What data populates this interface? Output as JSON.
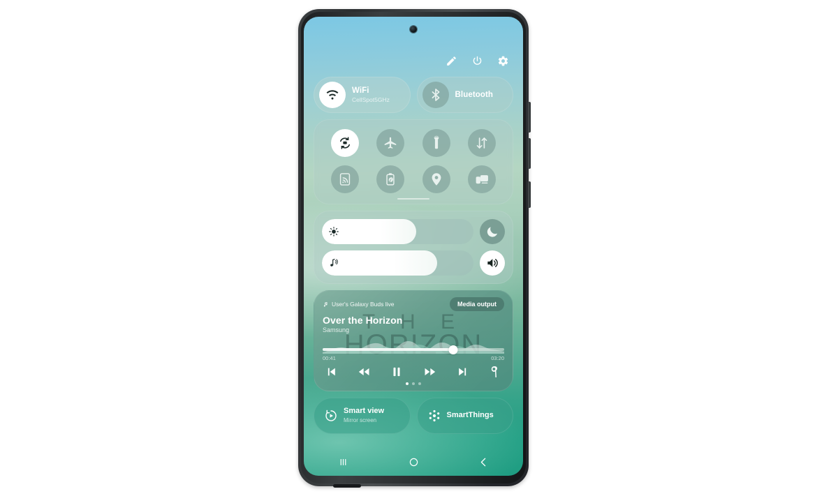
{
  "device": {
    "brand_frame_color": "#2b2e30",
    "screen_gradient": [
      "#7cc8e4",
      "#b4d6c2",
      "#1f9d82"
    ]
  },
  "header": {
    "icons": [
      {
        "name": "edit-icon",
        "label": "Edit"
      },
      {
        "name": "power-icon",
        "label": "Power off"
      },
      {
        "name": "settings-icon",
        "label": "Settings"
      }
    ]
  },
  "connectivity": [
    {
      "id": "wifi",
      "icon": "wifi-icon",
      "title": "WiFi",
      "subtitle": "CellSpot5GHz",
      "state": "on"
    },
    {
      "id": "bluetooth",
      "icon": "bluetooth-icon",
      "title": "Bluetooth",
      "subtitle": "",
      "state": "off"
    }
  ],
  "quick_toggles": [
    {
      "id": "auto-rotate",
      "icon": "auto-rotate-icon",
      "label": "Auto rotate",
      "state": "on"
    },
    {
      "id": "airplane-mode",
      "icon": "airplane-icon",
      "label": "Airplane mode",
      "state": "off"
    },
    {
      "id": "flashlight",
      "icon": "flashlight-icon",
      "label": "Flashlight",
      "state": "off"
    },
    {
      "id": "mobile-data",
      "icon": "mobile-data-icon",
      "label": "Mobile data",
      "state": "off"
    },
    {
      "id": "nfc",
      "icon": "nfc-icon",
      "label": "NFC",
      "state": "off"
    },
    {
      "id": "power-saving",
      "icon": "power-saving-icon",
      "label": "Power saving",
      "state": "off"
    },
    {
      "id": "location",
      "icon": "location-pin-icon",
      "label": "Location",
      "state": "off"
    },
    {
      "id": "screen-mirror",
      "icon": "screen-mirror-icon",
      "label": "Screen mirroring",
      "state": "off"
    }
  ],
  "sliders": [
    {
      "id": "brightness",
      "icon": "brightness-icon",
      "label": "Brightness",
      "value_percent": 62,
      "button": {
        "name": "dark-mode-button",
        "icon": "moon-icon",
        "label": "Dark mode",
        "state": "off"
      }
    },
    {
      "id": "volume",
      "icon": "media-volume-icon",
      "label": "Media volume",
      "value_percent": 76,
      "button": {
        "name": "sound-mode-button",
        "icon": "speaker-icon",
        "label": "Sound",
        "state": "on"
      }
    }
  ],
  "media": {
    "album_art_text_line1": "T H E",
    "album_art_text_line2": "HORIZON",
    "device_label": "User's Galaxy Buds live",
    "output_button": "Media output",
    "title": "Over the Horizon",
    "artist": "Samsung",
    "elapsed": "00:41",
    "duration": "03:20",
    "progress_percent": 72,
    "controls": [
      {
        "name": "previous-track-button",
        "icon": "skip-previous-icon",
        "label": "Previous"
      },
      {
        "name": "rewind-button",
        "icon": "rewind-icon",
        "label": "Rewind"
      },
      {
        "name": "pause-button",
        "icon": "pause-icon",
        "label": "Pause"
      },
      {
        "name": "fast-forward-button",
        "icon": "fast-forward-icon",
        "label": "Fast forward"
      },
      {
        "name": "next-track-button",
        "icon": "skip-next-icon",
        "label": "Next"
      },
      {
        "name": "earbuds-button",
        "icon": "earbuds-icon",
        "label": "Earbuds"
      }
    ],
    "page_dots": {
      "count": 3,
      "active_index": 0
    }
  },
  "bottom_tiles": [
    {
      "id": "smart-view",
      "icon": "smart-view-icon",
      "title": "Smart view",
      "subtitle": "Mirror screen"
    },
    {
      "id": "smartthings",
      "icon": "smartthings-icon",
      "title": "SmartThings",
      "subtitle": ""
    }
  ],
  "navbar": [
    {
      "name": "recents-button",
      "icon": "recents-icon",
      "label": "Recents"
    },
    {
      "name": "home-button",
      "icon": "home-icon",
      "label": "Home"
    },
    {
      "name": "back-button",
      "icon": "back-icon",
      "label": "Back"
    }
  ]
}
